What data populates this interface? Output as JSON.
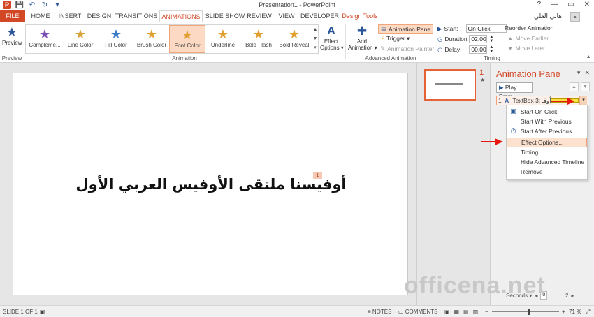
{
  "window": {
    "title": "Presentation1 - PowerPoint",
    "min": "?",
    "restore": "▭",
    "close": "✕",
    "help": "?"
  },
  "qat": {
    "logo": "P",
    "save": "💾",
    "undo": "↶",
    "redo": "↻",
    "customize": "▾"
  },
  "tabs": [
    "FILE",
    "HOME",
    "INSERT",
    "DESIGN",
    "TRANSITIONS",
    "ANIMATIONS",
    "SLIDE SHOW",
    "REVIEW",
    "VIEW",
    "DEVELOPER",
    "Design Tools"
  ],
  "user": {
    "name": "هاني العلي",
    "initial": "ه"
  },
  "ribbon": {
    "preview": {
      "label": "Preview",
      "group": "Preview"
    },
    "animations": [
      {
        "label": "Compleme...",
        "color": "#7a4fb3",
        "letter": ""
      },
      {
        "label": "Line Color",
        "color": "#d9a13a",
        "letter": ""
      },
      {
        "label": "Fill Color",
        "color": "#3a7bc8",
        "letter": ""
      },
      {
        "label": "Brush Color",
        "color": "#e0a030",
        "letter": "A"
      },
      {
        "label": "Font Color",
        "color": "#e0a030",
        "letter": "A"
      },
      {
        "label": "Underline",
        "color": "#e0a030",
        "letter": "U"
      },
      {
        "label": "Bold Flash",
        "color": "#e0a030",
        "letter": "B"
      },
      {
        "label": "Bold Reveal",
        "color": "#e0a030",
        "letter": "B"
      }
    ],
    "selected_animation": "Font Color",
    "animation_group": "Animation",
    "effect_options": {
      "line1": "Effect",
      "line2": "Options ▾"
    },
    "add_animation": {
      "line1": "Add",
      "line2": "Animation ▾"
    },
    "animation_pane": "Animation Pane",
    "trigger": "Trigger ▾",
    "animation_painter": "Animation Painter",
    "advanced_group": "Advanced Animation",
    "start": {
      "label": "Start:",
      "value": "On Click"
    },
    "duration": {
      "label": "Duration:",
      "value": "02.00"
    },
    "delay": {
      "label": "Delay:",
      "value": "00.00"
    },
    "reorder": {
      "title": "Reorder Animation",
      "earlier": "Move Earlier",
      "later": "Move Later"
    },
    "timing_group": "Timing"
  },
  "slide": {
    "text": "أوفيسنا ملتقى الأوفيس العربي الأول",
    "tag": "1"
  },
  "thumbnail": {
    "number": "1",
    "star": "★"
  },
  "pane": {
    "title": "Animation Pane",
    "play_from": "Play From",
    "item": {
      "index": "1",
      "letter": "A",
      "name": "TextBox 3: أوفـ"
    },
    "menu": [
      {
        "label": "Start On Click",
        "icon": "▣"
      },
      {
        "label": "Start With Previous",
        "icon": ""
      },
      {
        "label": "Start After Previous",
        "icon": "◷"
      },
      {
        "label": "Effect Options...",
        "icon": ""
      },
      {
        "label": "Timing...",
        "icon": ""
      },
      {
        "label": "Hide Advanced Timeline",
        "icon": ""
      },
      {
        "label": "Remove",
        "icon": ""
      }
    ],
    "seconds": "Seconds ▾",
    "timeline_start": "0",
    "timeline_end": "2"
  },
  "watermark": "officena.net",
  "status": {
    "slide": "SLIDE 1 OF 1",
    "notes": "NOTES",
    "comments": "COMMENTS",
    "zoom": "71 %"
  },
  "colors": {
    "accent": "#d24726",
    "highlight": "#fde1cf",
    "arrow": "#e8170f"
  }
}
